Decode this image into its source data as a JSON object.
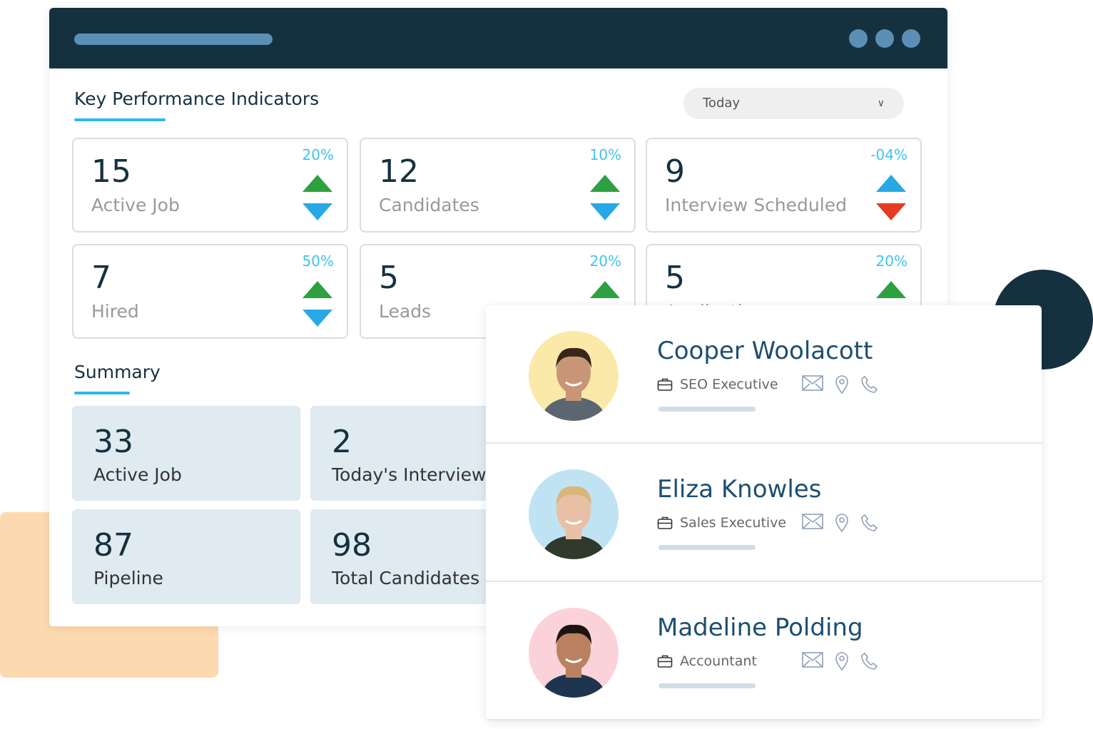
{
  "kpi": {
    "title": "Key Performance Indicators",
    "filter": "Today",
    "cards": [
      {
        "value": "15",
        "label": "Active Job",
        "change": "20%",
        "up_color": "#2ea040",
        "down_color": "#28a8e5"
      },
      {
        "value": "12",
        "label": "Candidates",
        "change": "10%",
        "up_color": "#2ea040",
        "down_color": "#28a8e5"
      },
      {
        "value": "9",
        "label": "Interview Scheduled",
        "change": "-04%",
        "up_color": "#28a8e5",
        "down_color": "#e53a24"
      },
      {
        "value": "7",
        "label": "Hired",
        "change": "50%",
        "up_color": "#2ea040",
        "down_color": "#28a8e5"
      },
      {
        "value": "5",
        "label": "Leads",
        "change": "20%",
        "up_color": "#2ea040",
        "down_color": "#28a8e5"
      },
      {
        "value": "5",
        "label": "Applications",
        "change": "20%",
        "up_color": "#2ea040",
        "down_color": "#28a8e5"
      }
    ]
  },
  "summary": {
    "title": "Summary",
    "cards": [
      {
        "value": "33",
        "label": "Active Job"
      },
      {
        "value": "2",
        "label": "Today's Interviews"
      },
      {
        "value": "87",
        "label": "Pipeline"
      },
      {
        "value": "98",
        "label": "Total Candidates"
      }
    ]
  },
  "candidates": [
    {
      "name": "Cooper Woolacott",
      "role": "SEO Executive",
      "avatar_bg": "#fbe9a9"
    },
    {
      "name": "Eliza Knowles",
      "role": "Sales Executive",
      "avatar_bg": "#bfe3f3"
    },
    {
      "name": "Madeline Polding",
      "role": "Accountant",
      "avatar_bg": "#fbd2da"
    }
  ]
}
